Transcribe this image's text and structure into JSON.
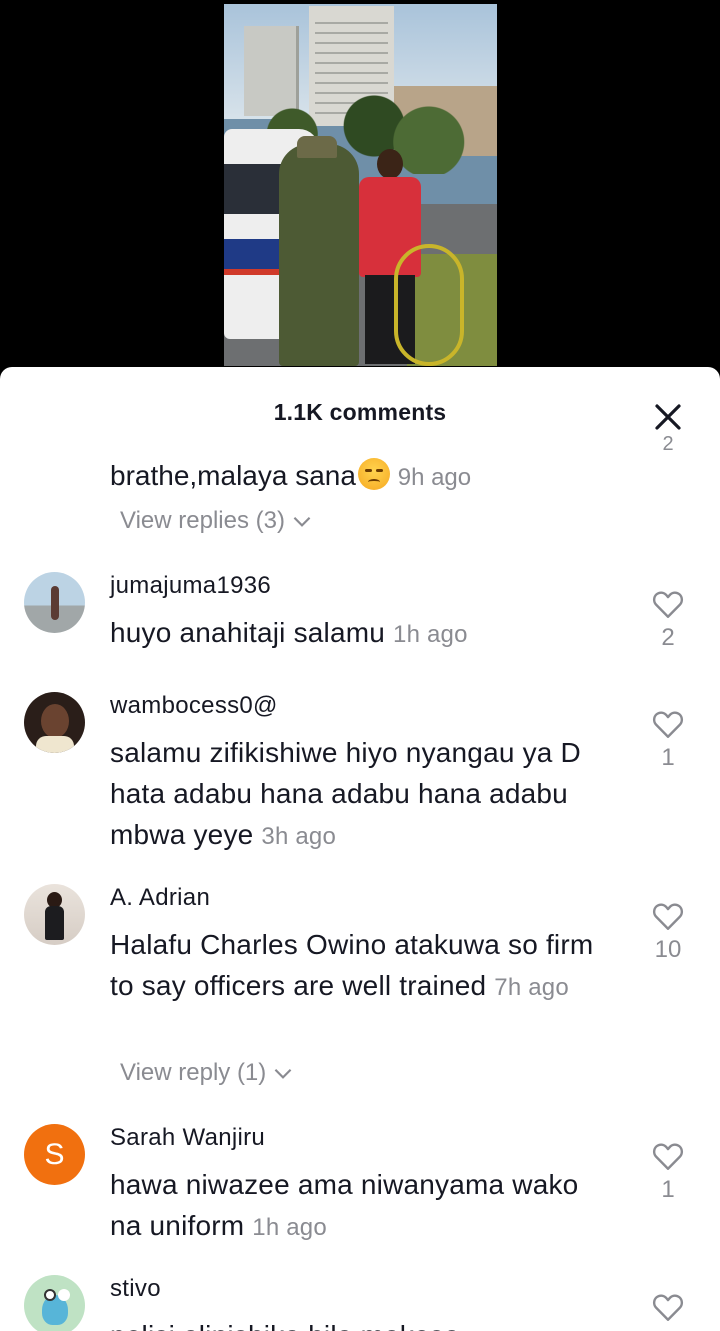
{
  "sheet": {
    "title": "1.1K comments"
  },
  "partial_comment": {
    "text": "brathe,malaya sana",
    "time": "9h ago",
    "like_count": "2"
  },
  "view_replies_1": "View replies (3)",
  "view_replies_2": "View reply (1)",
  "comments": [
    {
      "username": "jumajuma1936",
      "text": "huyo anahitaji salamu",
      "time": "1h ago",
      "likes": "2"
    },
    {
      "username": "wambocess0@",
      "text": "salamu zifikishiwe hiyo nyangau ya D hata adabu hana adabu hana adabu mbwa yeye",
      "time": "3h ago",
      "likes": "1"
    },
    {
      "username": "A. Adrian",
      "text": "Halafu Charles Owino atakuwa so firm to say officers are well trained",
      "time": "7h ago",
      "likes": "10"
    },
    {
      "username": "Sarah Wanjiru",
      "avatar_letter": "S",
      "text": "hawa niwazee ama niwanyama wako na uniform",
      "time": "1h ago",
      "likes": "1"
    },
    {
      "username": "stivo",
      "text": "polisi alinishika hila makosa"
    }
  ],
  "icons": {
    "close": "close-icon",
    "like": "heart-outline-icon",
    "expand": "chevron-down-icon"
  },
  "colors": {
    "avatar_orange": "#f1700f",
    "secondary_text": "#8a8b91",
    "primary_text": "#161823"
  }
}
